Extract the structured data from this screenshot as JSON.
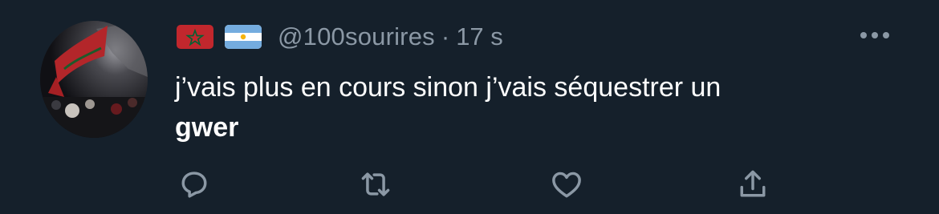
{
  "tweet": {
    "handle": "@100sourires",
    "separator": "·",
    "time": "17 s",
    "flags": [
      "morocco-flag",
      "argentina-flag"
    ],
    "text_line": "j’vais plus en cours sinon j’vais séquestrer un",
    "text_bold": "gwer"
  },
  "actions": [
    {
      "icon": "reply-icon"
    },
    {
      "icon": "retweet-icon"
    },
    {
      "icon": "like-icon"
    },
    {
      "icon": "share-icon"
    }
  ],
  "colors": {
    "background": "#15202b",
    "text": "#ffffff",
    "secondary": "#8b98a5",
    "morocco_red": "#c1272d",
    "morocco_green": "#006233",
    "argentina_blue": "#74acdf"
  }
}
